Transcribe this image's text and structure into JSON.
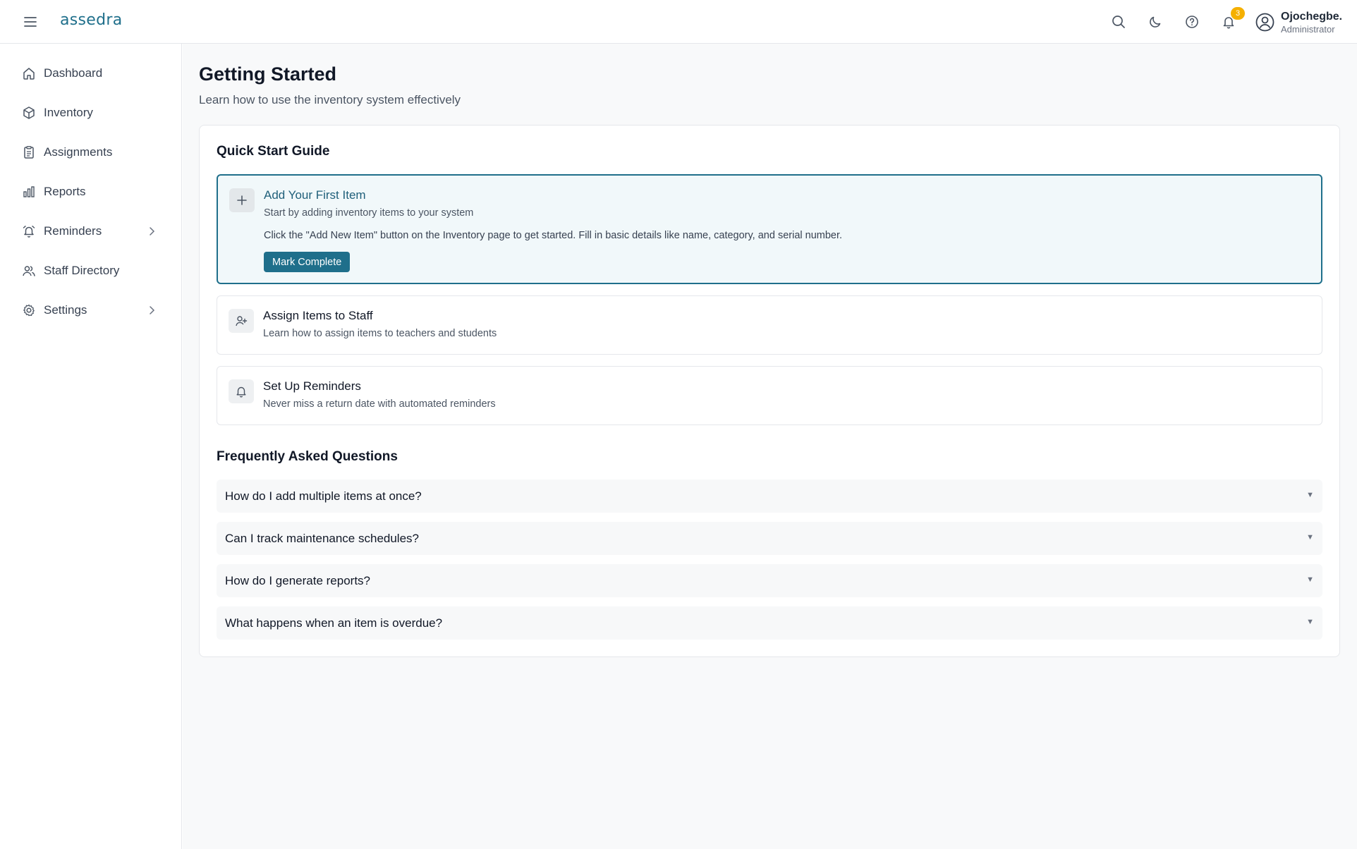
{
  "header": {
    "logo": "assedra",
    "notification_count": "3",
    "user_name": "Ojochegbe.",
    "user_role": "Administrator",
    "icons": [
      "menu-icon",
      "search-icon",
      "moon-icon",
      "help-icon",
      "bell-icon",
      "user-circle-icon"
    ]
  },
  "sidebar": {
    "items": [
      {
        "label": "Dashboard",
        "icon": "home-icon"
      },
      {
        "label": "Inventory",
        "icon": "box-icon"
      },
      {
        "label": "Assignments",
        "icon": "clipboard-icon"
      },
      {
        "label": "Reports",
        "icon": "bar-chart-icon"
      },
      {
        "label": "Reminders",
        "icon": "alarm-icon",
        "has_submenu": true
      },
      {
        "label": "Staff Directory",
        "icon": "users-icon"
      },
      {
        "label": "Settings",
        "icon": "gear-icon",
        "has_submenu": true
      }
    ]
  },
  "main": {
    "title": "Getting Started",
    "subtitle": "Learn how to use the inventory system effectively",
    "quick_start": {
      "title": "Quick Start Guide",
      "items": [
        {
          "title": "Add Your First Item",
          "description": "Start by adding inventory items to your system",
          "detail": "Click the \"Add New Item\" button on the Inventory page to get started. Fill in basic details like name, category, and serial number.",
          "button": "Mark Complete",
          "icon": "plus-icon",
          "expanded": true
        },
        {
          "title": "Assign Items to Staff",
          "description": "Learn how to assign items to teachers and students",
          "icon": "user-plus-icon"
        },
        {
          "title": "Set Up Reminders",
          "description": "Never miss a return date with automated reminders",
          "icon": "bell-icon"
        }
      ]
    },
    "faq": {
      "title": "Frequently Asked Questions",
      "items": [
        {
          "question": "How do I add multiple items at once?"
        },
        {
          "question": "Can I track maintenance schedules?"
        },
        {
          "question": "How do I generate reports?"
        },
        {
          "question": "What happens when an item is overdue?"
        }
      ]
    }
  },
  "colors": {
    "accent": "#1f6f8b",
    "badge": "#f5b000",
    "active_bg": "#f1f8fa"
  }
}
